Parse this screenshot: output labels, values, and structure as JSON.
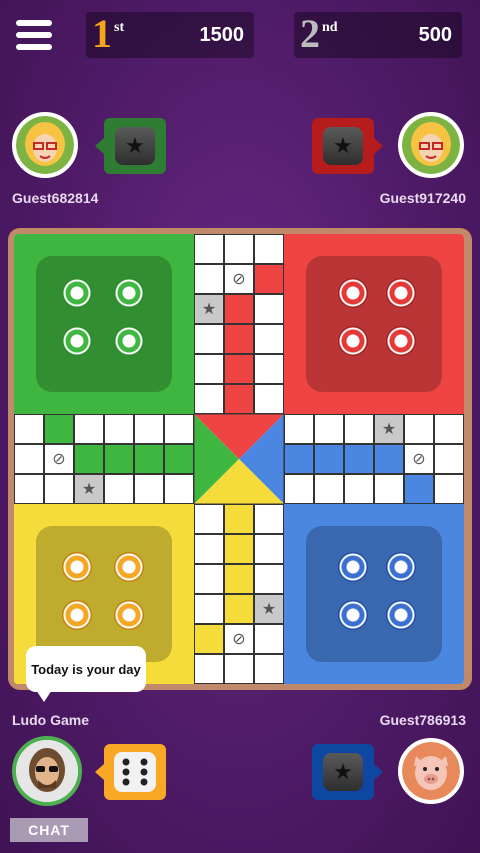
{
  "topbar": {
    "menu_icon": "hamburger-menu-icon",
    "rank1": {
      "num": "1",
      "suffix": "st",
      "score": "1500",
      "color": "#f7a51c"
    },
    "rank2": {
      "num": "2",
      "suffix": "nd",
      "score": "500",
      "color": "#bdbdbd"
    }
  },
  "players": {
    "top_left": {
      "name": "Guest682814",
      "avatar": "blonde-woman-glasses-avatar",
      "dice_color": "#2e7d32",
      "dice_face": "star-icon"
    },
    "top_right": {
      "name": "Guest917240",
      "avatar": "blonde-woman-glasses-avatar",
      "dice_color": "#b71c1c",
      "dice_face": "star-icon"
    },
    "bottom_left": {
      "name": "Ludo Game",
      "avatar": "man-sunglasses-avatar",
      "dice_color": "#f9a825",
      "dice_face": "six-dots"
    },
    "bottom_right": {
      "name": "Guest786913",
      "avatar": "pig-avatar",
      "dice_color": "#0d47a1",
      "dice_face": "star-icon"
    }
  },
  "chat_bubble": {
    "text": "Today is your day"
  },
  "chat_button": {
    "label": "CHAT"
  },
  "colors": {
    "green": "#3fb63f",
    "red": "#ef4444",
    "yellow": "#f5dc3a",
    "blue": "#4b86e0"
  }
}
